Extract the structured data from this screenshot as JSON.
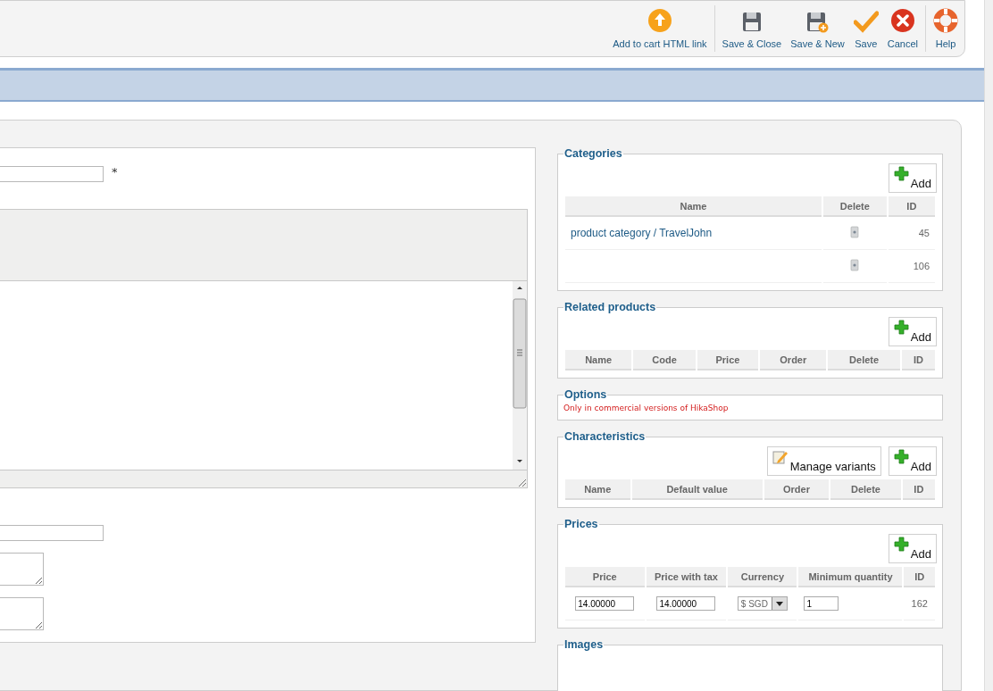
{
  "toolbar": {
    "groups": [
      [
        {
          "kind": "upload",
          "label": "Add to cart HTML link"
        }
      ],
      [
        {
          "kind": "save",
          "label": "Save & Close"
        },
        {
          "kind": "save-new",
          "label": "Save & New"
        },
        {
          "kind": "check",
          "label": "Save"
        },
        {
          "kind": "cancel",
          "label": "Cancel"
        }
      ],
      [
        {
          "kind": "help",
          "label": "Help"
        }
      ]
    ]
  },
  "form": {
    "required_mark": "*"
  },
  "sections": [
    {
      "kind": "categories",
      "title": "Categories",
      "buttons": [
        {
          "kind": "add",
          "label": "Add"
        }
      ],
      "columns": [
        "Name",
        "Delete",
        "ID"
      ],
      "rows": [
        {
          "name": "product category / TravelJohn",
          "id": "45"
        },
        {
          "id": "106"
        }
      ]
    },
    {
      "kind": "table",
      "title": "Related products",
      "buttons": [
        {
          "kind": "add",
          "label": "Add"
        }
      ],
      "columns": [
        "Name",
        "Code",
        "Price",
        "Order",
        "Delete",
        "ID"
      ]
    },
    {
      "kind": "note",
      "title": "Options",
      "note": "Only in commercial versions of HikaShop"
    },
    {
      "kind": "table",
      "title": "Characteristics",
      "buttons": [
        {
          "kind": "manage",
          "label": "Manage variants"
        },
        {
          "kind": "add",
          "label": "Add"
        }
      ],
      "columns": [
        "Name",
        "Default value",
        "Order",
        "Delete",
        "ID"
      ]
    },
    {
      "kind": "prices",
      "title": "Prices",
      "buttons": [
        {
          "kind": "add",
          "label": "Add"
        }
      ],
      "columns": [
        "Price",
        "Price with tax",
        "Currency",
        "Minimum quantity",
        "ID"
      ],
      "rows": [
        {
          "price": "14.00000",
          "price_with_tax": "14.00000",
          "currency": "$ SGD",
          "minimum_quantity": "1",
          "id": "162"
        }
      ]
    },
    {
      "kind": "empty",
      "title": "Images"
    }
  ]
}
